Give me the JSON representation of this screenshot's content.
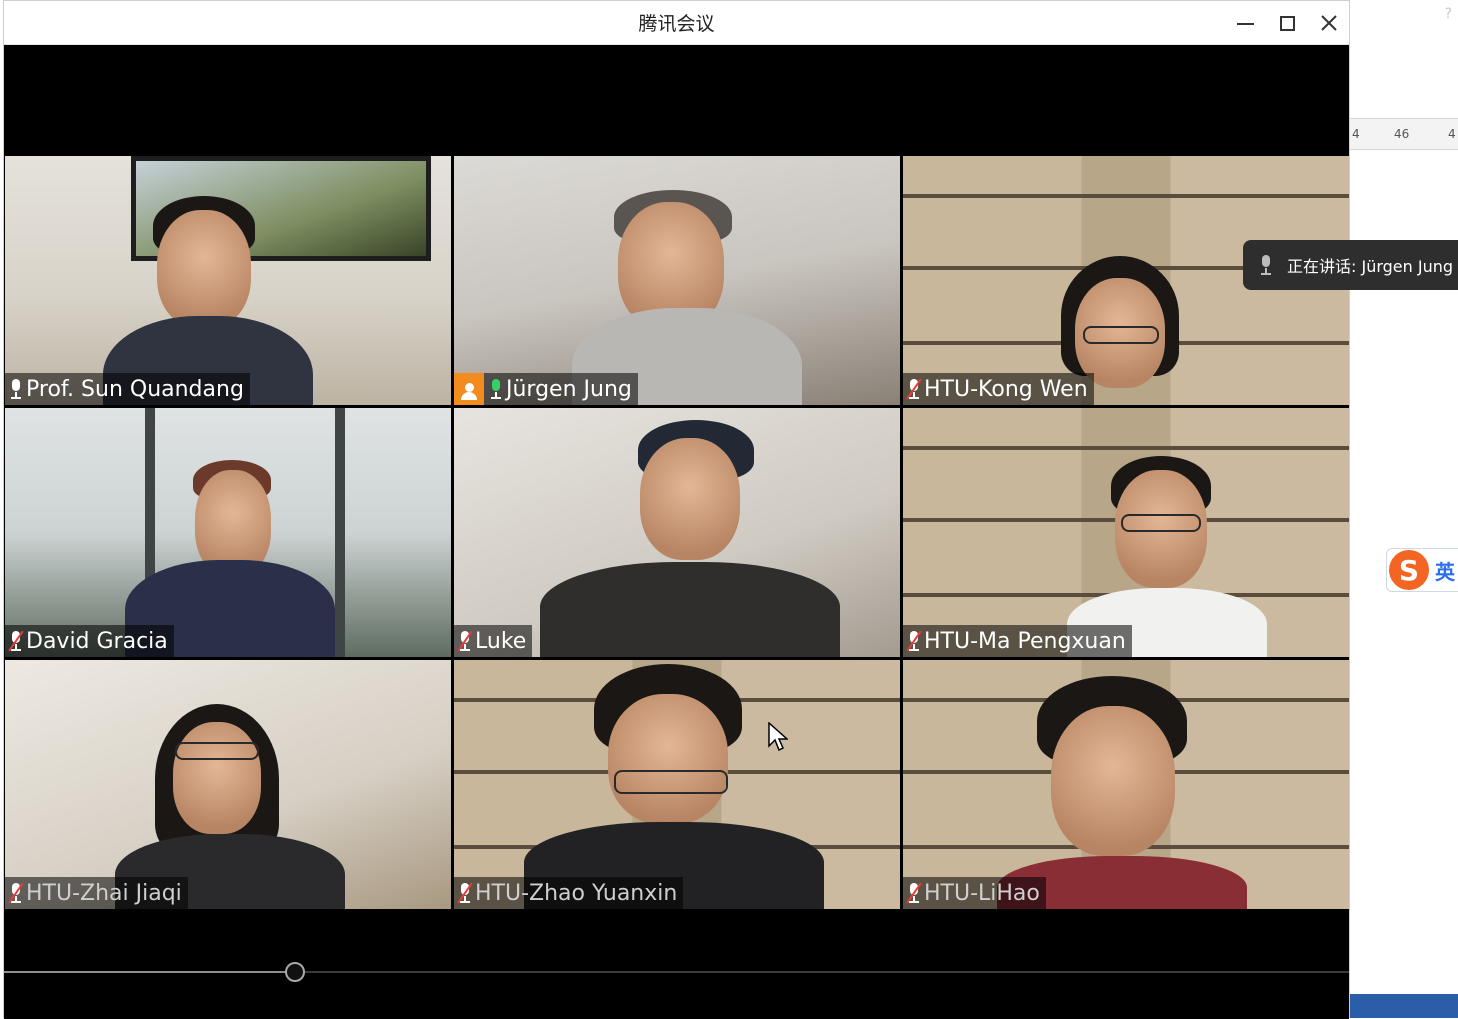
{
  "window": {
    "title": "腾讯会议"
  },
  "speaking_toast": {
    "text": "正在讲话: Jürgen Jung"
  },
  "participants": [
    {
      "name": "Prof. Sun Quandang",
      "mic": "on",
      "host": false
    },
    {
      "name": "Jürgen Jung",
      "mic": "speaking",
      "host": true
    },
    {
      "name": "HTU-Kong Wen",
      "mic": "muted",
      "host": false
    },
    {
      "name": "David Gracia",
      "mic": "muted",
      "host": false
    },
    {
      "name": "Luke",
      "mic": "muted",
      "host": false
    },
    {
      "name": "HTU-Ma Pengxuan",
      "mic": "muted",
      "host": false
    },
    {
      "name": "HTU-Zhai Jiaqi",
      "mic": "muted",
      "host": false
    },
    {
      "name": "HTU-Zhao Yuanxin",
      "mic": "muted",
      "host": false
    },
    {
      "name": "HTU-LiHao",
      "mic": "muted",
      "host": false
    }
  ],
  "playback": {
    "progress_fraction": 0.216
  },
  "background_app": {
    "help": "?",
    "ruler_ticks": [
      "4",
      "46",
      "4"
    ],
    "ime_logo": "S",
    "ime_lang": "英"
  },
  "colors": {
    "active_speaker_border": "#22c56b",
    "host_badge": "#f28c1f",
    "muted_slash": "#e83b3b"
  },
  "icons": {
    "minimize": "minimize-icon",
    "maximize": "maximize-icon",
    "close": "close-icon",
    "mic": "microphone-icon",
    "mic_muted": "microphone-muted-icon",
    "host": "host-person-icon"
  }
}
